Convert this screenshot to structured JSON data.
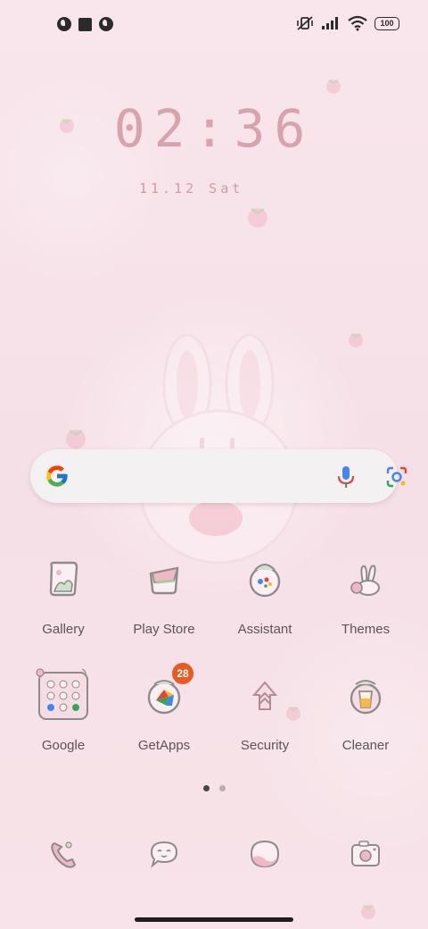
{
  "status_bar": {
    "battery_level": "100",
    "icons": [
      "app-notification-icon",
      "square-notification-icon",
      "app-notification-icon",
      "muted-vibrate-icon",
      "signal-icon",
      "wifi-icon",
      "battery-icon"
    ]
  },
  "clock": {
    "time": "02:36",
    "date": "11.12 Sat"
  },
  "search_bar": {
    "icons": [
      "google-g-icon",
      "mic-icon",
      "lens-camera-icon"
    ]
  },
  "apps": [
    {
      "label": "Gallery",
      "icon": "gallery-icon"
    },
    {
      "label": "Play Store",
      "icon": "play-store-icon"
    },
    {
      "label": "Assistant",
      "icon": "assistant-icon"
    },
    {
      "label": "Themes",
      "icon": "themes-icon"
    },
    {
      "label": "Google",
      "icon": "google-folder-icon"
    },
    {
      "label": "GetApps",
      "icon": "getapps-icon",
      "badge": "28"
    },
    {
      "label": "Security",
      "icon": "security-icon"
    },
    {
      "label": "Cleaner",
      "icon": "cleaner-icon"
    }
  ],
  "page_indicator": {
    "pages": 2,
    "current": 1
  },
  "dock": [
    {
      "icon": "phone-icon"
    },
    {
      "icon": "messages-icon"
    },
    {
      "icon": "browser-icon"
    },
    {
      "icon": "camera-icon"
    }
  ],
  "colors": {
    "clock": "#d8a3ac",
    "badge": "#e85a1f",
    "label": "#5c5557",
    "icon_line": "#8f8a8c",
    "icon_pink": "#f0b8c4"
  }
}
